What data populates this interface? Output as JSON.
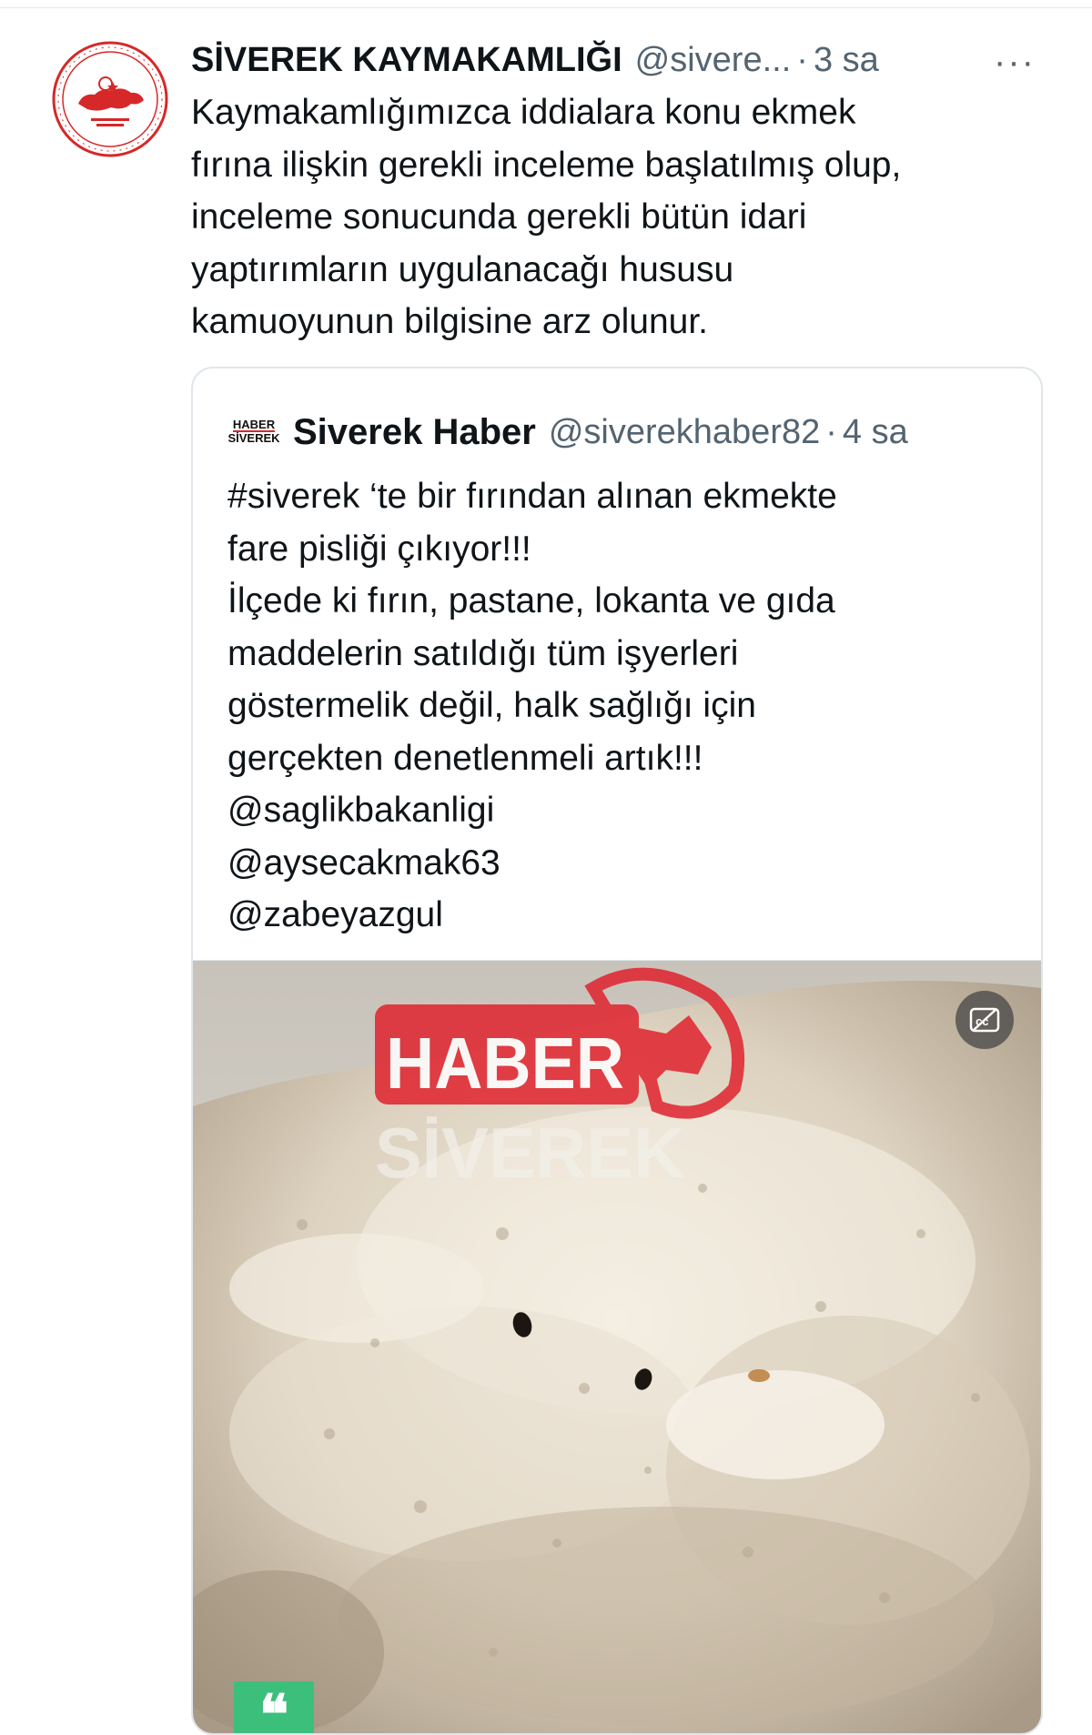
{
  "tweet": {
    "author_name": "SİVEREK KAYMAKAMLIĞI",
    "author_handle": "@sivere...",
    "separator": "·",
    "time": "3 sa",
    "more_icon": "···",
    "text_lines": [
      "Kaymakamlığımızca iddialara konu ekmek",
      "fırına ilişkin gerekli inceleme başlatılmış olup,",
      "inceleme sonucunda gerekli bütün idari",
      "yaptırımların uygulanacağı hususu",
      "kamuoyunun bilgisine arz olunur."
    ]
  },
  "quoted_tweet": {
    "avatar_top": "HABER",
    "avatar_bottom": "SİVEREK",
    "author_name": "Siverek Haber",
    "author_handle": "@siverekhaber82",
    "separator": "·",
    "time": "4 sa",
    "text_lines": [
      "#siverek ‘te bir fırından alınan ekmekte",
      "fare pisliği çıkıyor!!!",
      "İlçede ki fırın, pastane, lokanta ve gıda",
      "maddelerin satıldığı tüm işyerleri",
      "göstermelik değil, halk sağlığı için",
      "gerçekten denetlenmeli artık!!!",
      "@saglikbakanligi",
      "@aysecakmak63",
      "@zabeyazgul"
    ],
    "media": {
      "watermark_top": "HABER",
      "watermark_bottom": "SİVEREK",
      "cc_icon": "cc-icon",
      "quote_badge": "❝"
    }
  },
  "colors": {
    "text": "#0f1419",
    "muted": "#536471",
    "border": "#e1e6ea",
    "seal_red": "#d62828",
    "watermark_red": "#e0232e",
    "badge_green": "#3dbf7c"
  }
}
